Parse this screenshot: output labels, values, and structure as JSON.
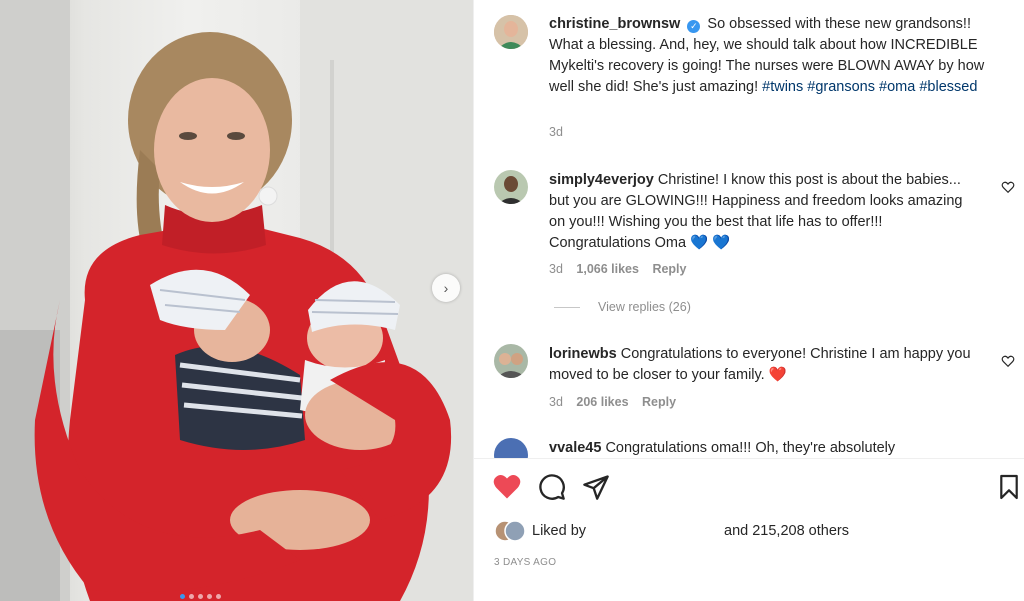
{
  "post": {
    "username": "christine_brownsw",
    "caption": "So obsessed with these new grandsons!! What a blessing. And, hey, we should talk about how INCREDIBLE Mykelti's recovery is going! The nurses were BLOWN AWAY by how well she did! She's just amazing!",
    "hashtags": [
      "#twins",
      "#gransons",
      "#oma",
      "#blessed"
    ],
    "age": "3d",
    "verified_icon": "verified-badge-icon"
  },
  "comments": [
    {
      "username": "simply4everjoy",
      "text": "Christine! I know this post is about the babies... but you are GLOWING!!! Happiness and freedom looks amazing on you!!! Wishing you the best that life has to offer!!! Congratulations Oma",
      "emoji": "💙 💙",
      "age": "3d",
      "likes": "1,066 likes",
      "reply": "Reply"
    },
    {
      "username": "lorinewbs",
      "text": "Congratulations to everyone! Christine I am happy you moved to be closer to your family.",
      "emoji": "❤️",
      "age": "3d",
      "likes": "206 likes",
      "reply": "Reply"
    },
    {
      "username": "vvale45",
      "text": "Congratulations oma!!! Oh, they're absolutely"
    }
  ],
  "view_replies": "View replies (26)",
  "footer": {
    "liked_by": "Liked by",
    "others": "and 215,208 others",
    "timestamp": "3 DAYS AGO"
  },
  "colors": {
    "like_red": "#ed4956",
    "hashtag_blue": "#00376b",
    "muted": "#8e8e8e"
  },
  "carousel": {
    "slides": 5,
    "active": 1
  }
}
